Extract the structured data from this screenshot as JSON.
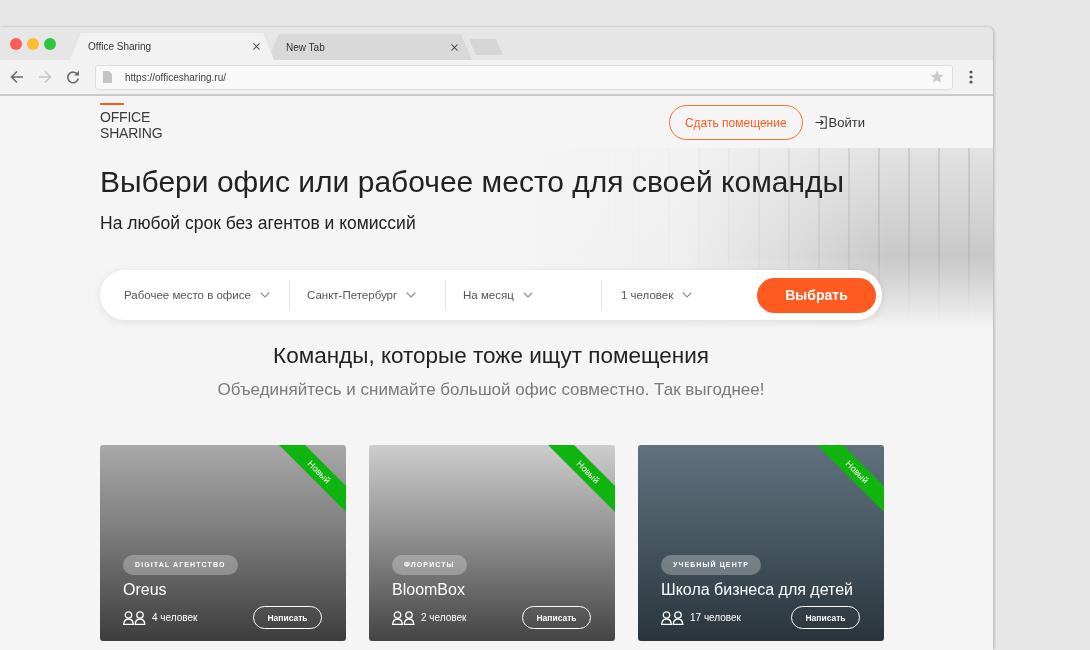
{
  "browser": {
    "tabs": [
      {
        "title": "Office Sharing",
        "selected": true
      },
      {
        "title": "New Tab",
        "selected": false
      }
    ],
    "nav_buttons": [
      {
        "kind": "back",
        "disabled": false
      },
      {
        "kind": "forward",
        "disabled": true
      },
      {
        "kind": "reload",
        "disabled": false
      }
    ],
    "address": "https://officesharing.ru/"
  },
  "header": {
    "logo": "OFFICE SHARING",
    "list_button": "Сдать помещение",
    "login": "Войти"
  },
  "hero": {
    "title": "Выбери офис или рабочее место для своей команды",
    "subtitle": "На любой срок без агентов и комиссий"
  },
  "search": {
    "filters": [
      "Рабочее место в офисе",
      "Санкт-Петербург",
      "На месяц",
      "1 человек"
    ],
    "button": "Выбрать"
  },
  "teams": {
    "title": "Команды, которые тоже ищут помещения",
    "subtitle": "Объединяйтесь и снимайте большой офис совместно. Так выгоднее!",
    "cards": [
      {
        "ribbon": "Новый",
        "category": "DIGITAL АГЕНТСТВО",
        "name": "Oreus",
        "members": "4 человек",
        "button": "Написать"
      },
      {
        "ribbon": "Новый",
        "category": "ФЛОРИСТЫ",
        "name": "BloomBox",
        "members": "2 человек",
        "button": "Написать"
      },
      {
        "ribbon": "Новый",
        "category": "УЧЕБНЫЙ ЦЕНТР",
        "name": "Школа бизнеса для детей",
        "members": "17 человек",
        "button": "Написать"
      }
    ]
  }
}
